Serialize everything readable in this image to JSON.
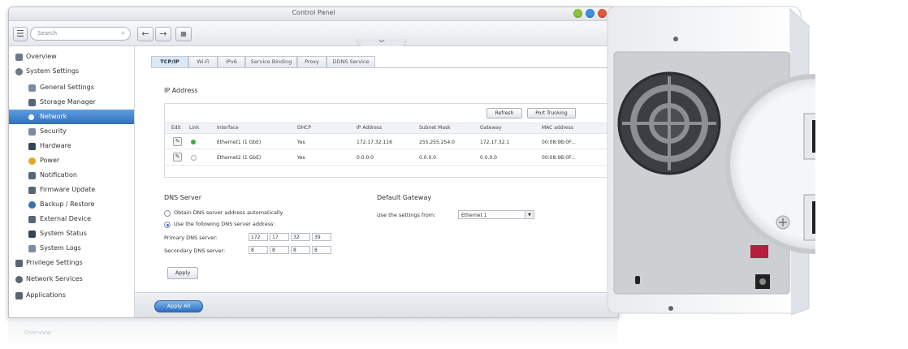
{
  "window": {
    "title": "Control Panel"
  },
  "toolbar": {
    "search_placeholder": "Search"
  },
  "sidebar": {
    "items": [
      {
        "label": "Overview",
        "color": "#6d7a89"
      },
      {
        "label": "System Settings",
        "color": "#6d7a89"
      },
      {
        "label": "General Settings",
        "color": "#7c8da3"
      },
      {
        "label": "Storage Manager",
        "color": "#556677"
      },
      {
        "label": "Network",
        "color": "#ffffff"
      },
      {
        "label": "Security",
        "color": "#7c8da3"
      },
      {
        "label": "Hardware",
        "color": "#334455"
      },
      {
        "label": "Power",
        "color": "#e2a92a"
      },
      {
        "label": "Notification",
        "color": "#556677"
      },
      {
        "label": "Firmware Update",
        "color": "#556677"
      },
      {
        "label": "Backup / Restore",
        "color": "#3b6fb3"
      },
      {
        "label": "External Device",
        "color": "#556677"
      },
      {
        "label": "System Status",
        "color": "#334455"
      },
      {
        "label": "System Logs",
        "color": "#7c8da3"
      },
      {
        "label": "Privilege Settings",
        "color": "#556677"
      },
      {
        "label": "Network Services",
        "color": "#556677"
      },
      {
        "label": "Applications",
        "color": "#556677"
      }
    ],
    "footer_label": "Overview"
  },
  "tabs": [
    "TCP/IP",
    "Wi-Fi",
    "IPv6",
    "Service Binding",
    "Proxy",
    "DDNS Service"
  ],
  "ip_section": {
    "title": "IP Address",
    "refresh_label": "Refresh",
    "port_trunking_label": "Port Trunking",
    "columns": [
      "Edit",
      "Link",
      "Interface",
      "DHCP",
      "IP Address",
      "Subnet Mask",
      "Gateway",
      "MAC address"
    ],
    "rows": [
      {
        "interface": "Ethernet1 (1 GbE)",
        "dhcp": "Yes",
        "ip": "172.17.32.116",
        "mask": "255.255.254.0",
        "gateway": "172.17.32.1",
        "mac": "00:08:9B:0F:..",
        "link": "up"
      },
      {
        "interface": "Ethernet2 (1 GbE)",
        "dhcp": "Yes",
        "ip": "0.0.0.0",
        "mask": "0.0.0.0",
        "gateway": "0.0.0.0",
        "mac": "00:08:9B:0F:..",
        "link": "down"
      }
    ]
  },
  "dns": {
    "title": "DNS Server",
    "option_auto": "Obtain DNS server address automatically",
    "option_manual": "Use the following DNS server address:",
    "primary_label": "Primary DNS server:",
    "secondary_label": "Secondary DNS server:",
    "primary": [
      "172",
      "17",
      "32",
      "39"
    ],
    "secondary": [
      "8",
      "8",
      "8",
      "8"
    ],
    "apply_label": "Apply"
  },
  "gateway": {
    "title": "Default Gateway",
    "label": "Use the settings from:",
    "value": "Ethernet 1"
  },
  "footer": {
    "apply_all_label": "Apply All"
  },
  "colors": {
    "accent": "#2f6fbe",
    "link_up": "#3cae3c",
    "link_down": "#aaaaaa"
  }
}
